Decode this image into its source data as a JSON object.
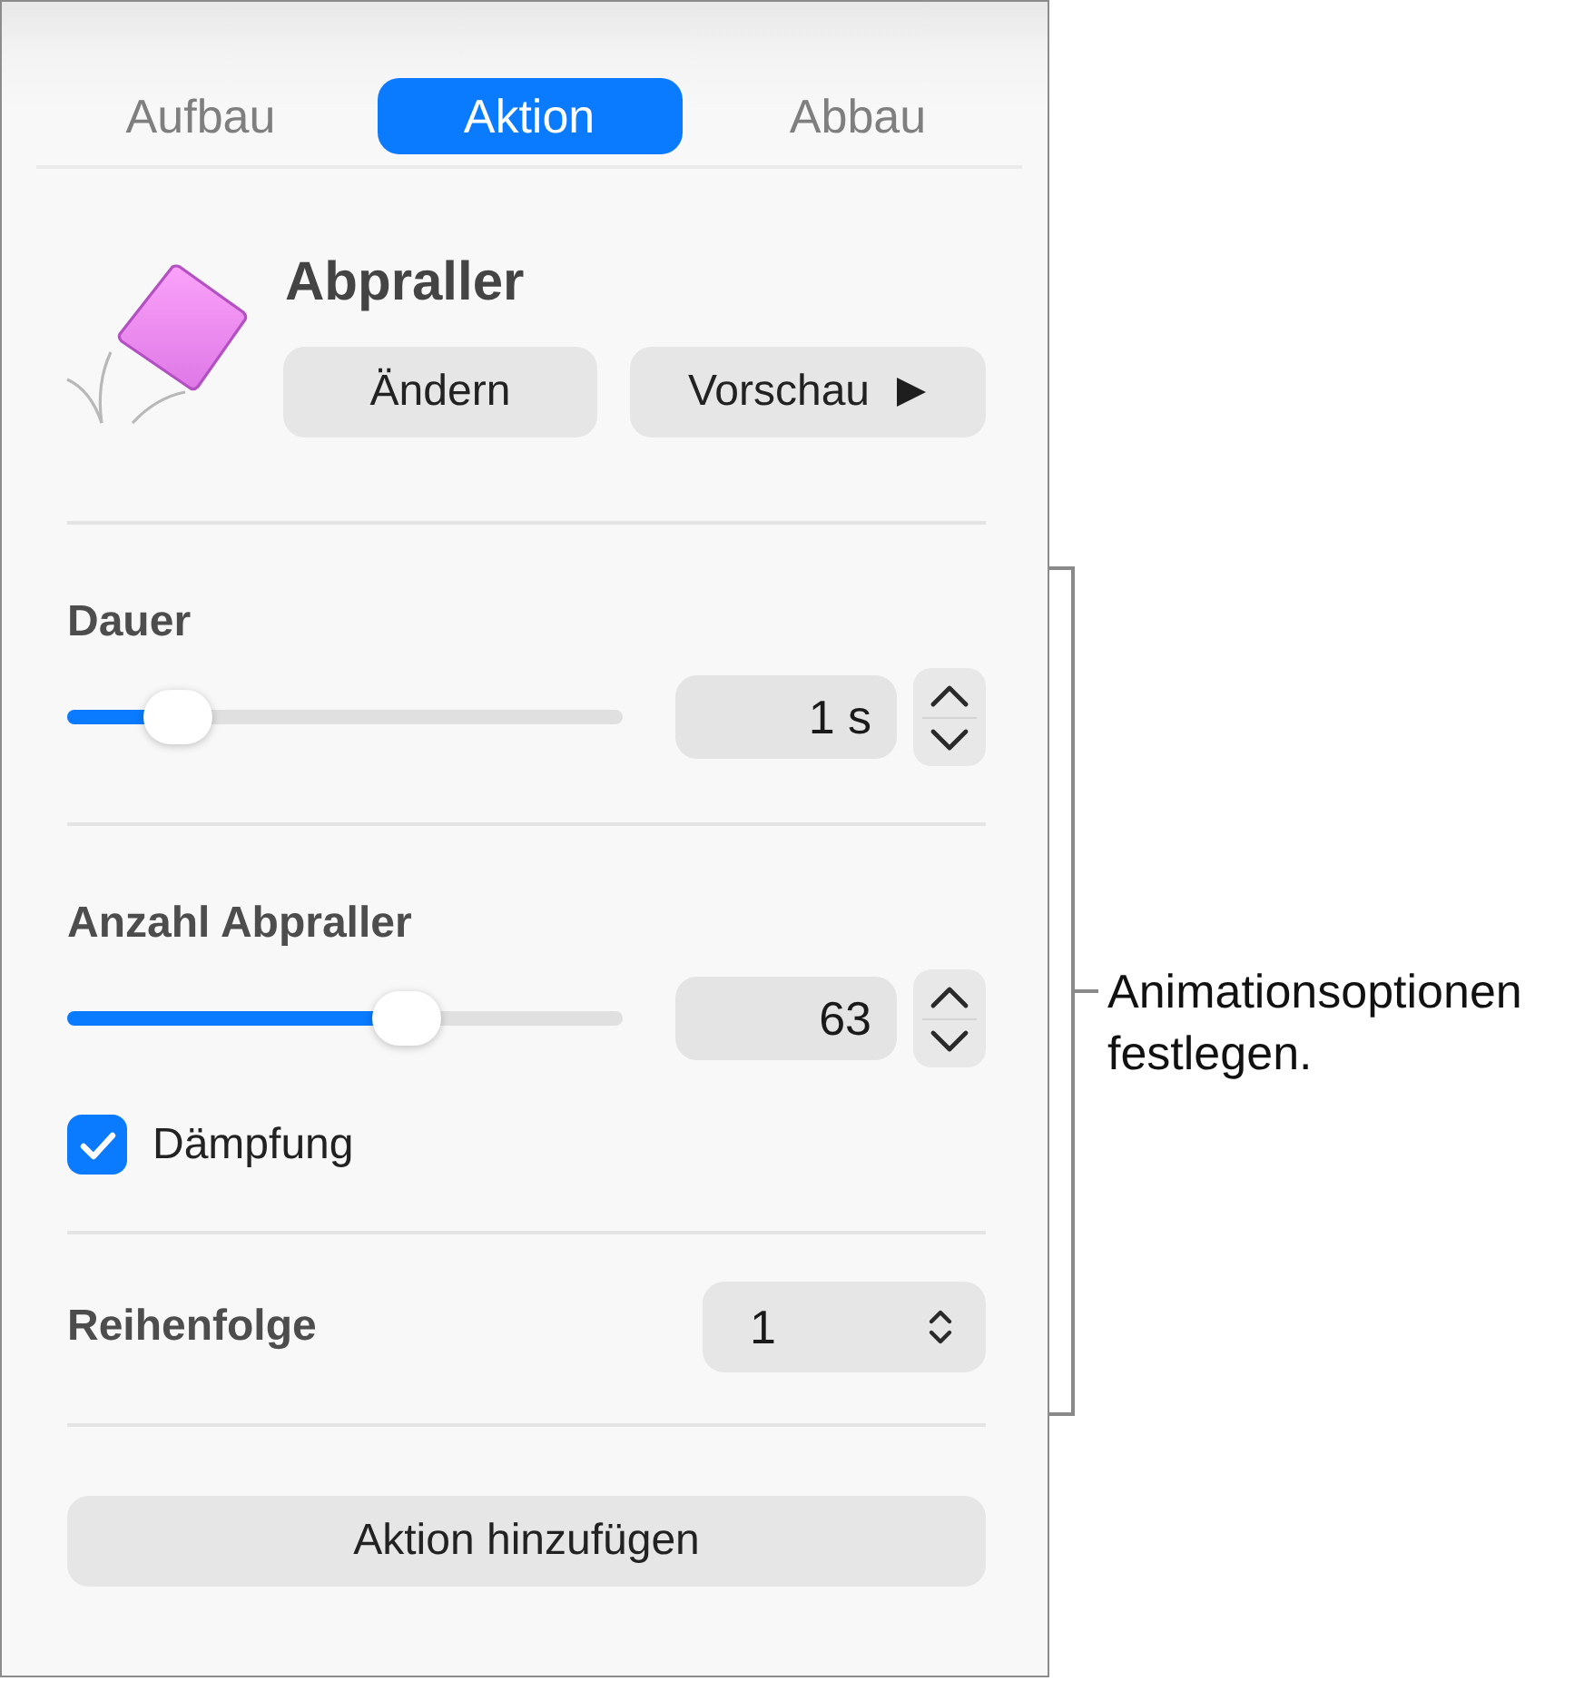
{
  "tabs": [
    {
      "label": "Aufbau",
      "selected": false
    },
    {
      "label": "Aktion",
      "selected": true
    },
    {
      "label": "Abbau",
      "selected": false
    }
  ],
  "effect": {
    "name": "Abpraller",
    "buttons": [
      {
        "label": "Ändern",
        "kind": "plain"
      },
      {
        "label": "Vorschau",
        "kind": "play"
      }
    ]
  },
  "sections": [
    {
      "rows": [
        {
          "kind": "slider",
          "label": "Dauer",
          "level": 0.2,
          "value": "1 s"
        }
      ]
    },
    {
      "rows": [
        {
          "kind": "slider",
          "label": "Anzahl Abpraller",
          "level": 0.61,
          "value": "63"
        },
        {
          "kind": "checkbox",
          "label": "Dämpfung",
          "checked": true
        }
      ]
    },
    {
      "rows": [
        {
          "kind": "popup",
          "label": "Reihenfolge",
          "value": "1"
        }
      ]
    }
  ],
  "add_button": "Aktion hinzufügen",
  "callout": "Animationsoptionen festlegen."
}
